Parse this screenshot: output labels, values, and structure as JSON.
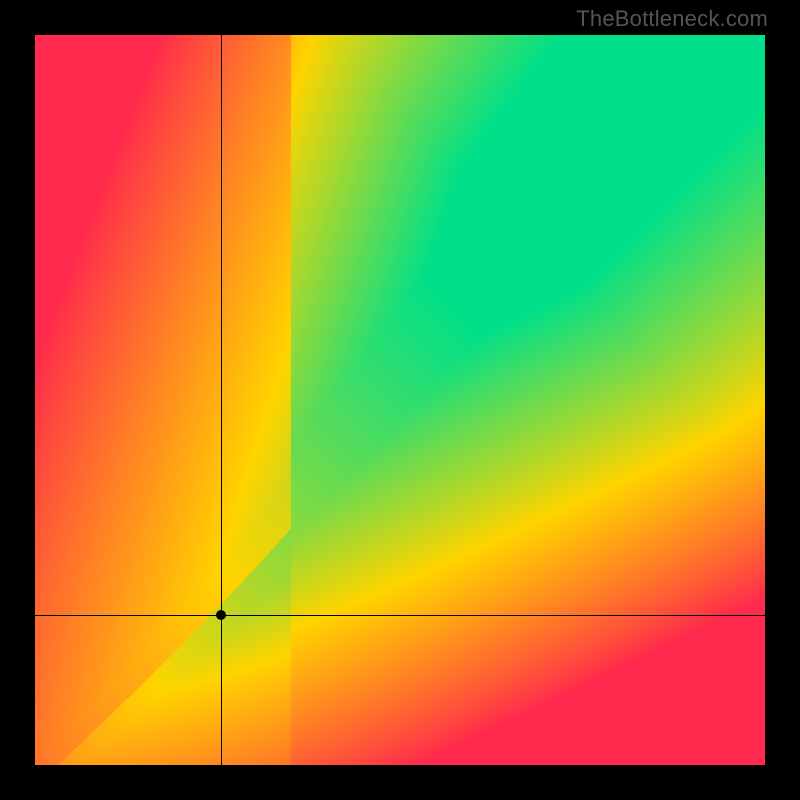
{
  "watermark": "TheBottleneck.com",
  "chart_data": {
    "type": "heatmap",
    "title": "",
    "xlabel": "",
    "ylabel": "",
    "xlim": [
      0,
      1
    ],
    "ylim": [
      0,
      1
    ],
    "crosshair": {
      "x": 0.255,
      "y": 0.205
    },
    "marker": {
      "x": 0.255,
      "y": 0.205
    },
    "optimal_band": {
      "slope": 1.15,
      "intercept": -0.03,
      "width": 0.07,
      "curve_pull": 0.05
    },
    "palette": {
      "low": "#ff2a4d",
      "mid": "#ffd400",
      "high": "#00e08a"
    },
    "grid": false,
    "legend": false
  }
}
